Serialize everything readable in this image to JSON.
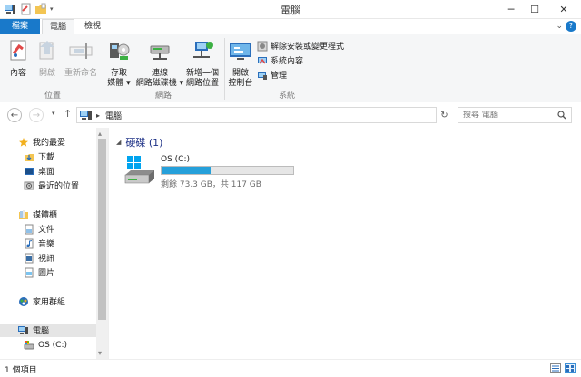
{
  "window": {
    "title": "電腦",
    "minimize": "─",
    "maximize": "☐",
    "close": "✕"
  },
  "ribbon_tabs": {
    "file": "檔案",
    "computer": "電腦",
    "view": "檢視"
  },
  "ribbon": {
    "location_group": "位置",
    "network_group": "網路",
    "system_group": "系統",
    "properties": "內容",
    "open": "開啟",
    "rename": "重新命名",
    "access_media_1": "存取",
    "access_media_2": "媒體 ▾",
    "map_drive_1": "連線",
    "map_drive_2": "網路磁碟機 ▾",
    "add_location_1": "新增一個",
    "add_location_2": "網路位置",
    "control_panel_1": "開啟",
    "control_panel_2": "控制台",
    "uninstall": "解除安裝或變更程式",
    "system_properties": "系統內容",
    "manage": "管理"
  },
  "address": {
    "location": "電腦",
    "search_placeholder": "搜尋 電腦"
  },
  "nav": {
    "favorites": "我的最愛",
    "downloads": "下載",
    "desktop": "桌面",
    "recent": "最近的位置",
    "libraries": "媒體櫃",
    "documents": "文件",
    "music": "音樂",
    "videos": "視訊",
    "pictures": "圖片",
    "homegroup": "家用群組",
    "computer": "電腦",
    "os_drive": "OS (C:)"
  },
  "content": {
    "group_title": "硬碟 (1)",
    "drive_name": "OS (C:)",
    "drive_space": "剩餘 73.3 GB，共 117 GB",
    "used_fraction": 0.373
  },
  "status": {
    "item_count": "1 個項目"
  },
  "colors": {
    "accent": "#1979ca",
    "usage_bar": "#26a0da",
    "group_header": "#1e3287"
  }
}
